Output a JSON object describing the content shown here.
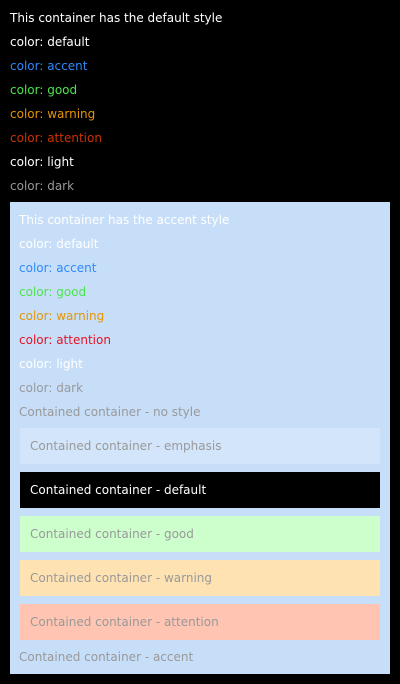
{
  "colors": {
    "page_bg": "#000000",
    "accent_container_bg": "#C7DEF9",
    "default": "#FFFFFF",
    "accent": "#2E89FC",
    "good": "#4CE44C",
    "warning": "#E69500",
    "attention": "#CC3300",
    "light": "#FFFFFF",
    "dark": "#999999",
    "accent_default": "#FFFFFF",
    "accent_accent": "#2E89FC",
    "accent_good": "#4CE44C",
    "accent_warning": "#E69500",
    "accent_attention": "#E81123",
    "accent_light": "#FFFFFF",
    "accent_dark": "#999999",
    "contained_text": "#999999",
    "emphasis_bg": "#D3E5FB",
    "default_bg": "#000000",
    "good_bg": "#CCFFCC",
    "warning_bg": "#FFE2B2",
    "attention_bg": "#FFC5B2"
  },
  "default_section": {
    "title": "This container has the default style",
    "lines": [
      "color: default",
      "color: accent",
      "color: good",
      "color: warning",
      "color: attention",
      "color: light",
      "color: dark"
    ]
  },
  "accent_section": {
    "title": "This container has the accent style",
    "lines": [
      "color: default",
      "color: accent",
      "color: good",
      "color: warning",
      "color: attention",
      "color: light",
      "color: dark"
    ],
    "contained": [
      "Contained container - no style",
      "Contained container - emphasis",
      "Contained container - default",
      "Contained container - good",
      "Contained container - warning",
      "Contained container - attention",
      "Contained container - accent"
    ]
  }
}
